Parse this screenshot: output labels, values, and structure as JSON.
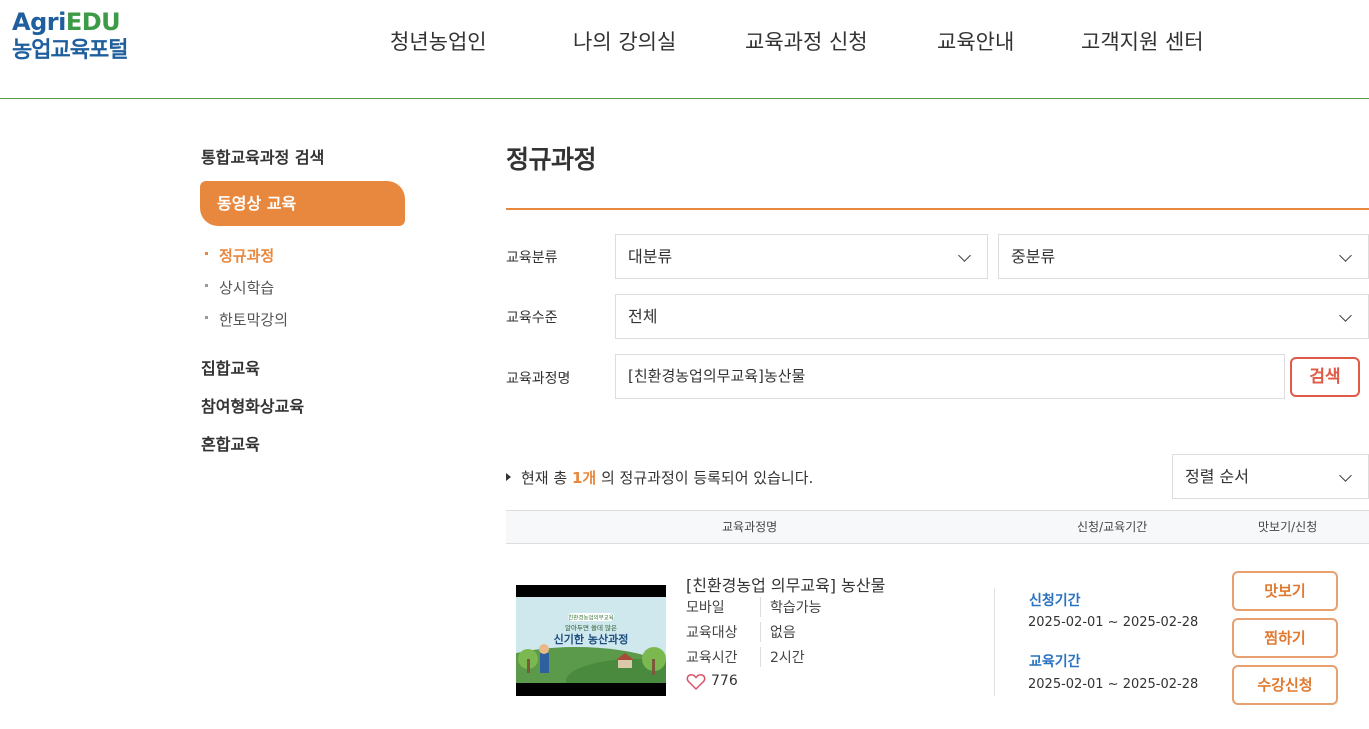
{
  "logo": {
    "agri": "Agri",
    "edu": "EDU",
    "sub": "농업교육포털"
  },
  "gnb": [
    "청년농업인",
    "나의 강의실",
    "교육과정 신청",
    "교육안내",
    "고객지원 센터"
  ],
  "sidebar": {
    "title": "통합교육과정 검색",
    "active": "동영상 교육",
    "sub": [
      "정규과정",
      "상시학습",
      "한토막강의"
    ],
    "main": [
      "집합교육",
      "참여형화상교육",
      "혼합교육"
    ]
  },
  "page": {
    "title": "정규과정"
  },
  "filters": {
    "category_label": "교육분류",
    "major": "대분류",
    "middle": "중분류",
    "level_label": "교육수준",
    "level": "전체",
    "name_label": "교육과정명",
    "name_value": "[친환경농업의무교육]농산물",
    "search_button": "검색"
  },
  "result": {
    "prefix": "현재 총",
    "count": "1개",
    "suffix": "의 정규과정이 등록되어 있습니다.",
    "sort": "정렬 순서"
  },
  "table": {
    "headers": [
      "교육과정명",
      "신청/교육기간",
      "맛보기/신청"
    ]
  },
  "course": {
    "thumb_tag": "친환경농업의무교육",
    "thumb_sub": "알아두면 쓸데 많은",
    "thumb_title": "신기한 농산과정",
    "title": "[친환경농업 의무교육] 농산물",
    "meta": [
      {
        "label": "모바일",
        "value": "학습가능"
      },
      {
        "label": "교육대상",
        "value": "없음"
      },
      {
        "label": "교육시간",
        "value": "2시간"
      }
    ],
    "likes": "776",
    "apply_label": "신청기간",
    "apply_period": "2025-02-01 ~ 2025-02-28",
    "edu_label": "교육기간",
    "edu_period": "2025-02-01 ~ 2025-02-28",
    "buttons": [
      "맛보기",
      "찜하기",
      "수강신청"
    ]
  }
}
